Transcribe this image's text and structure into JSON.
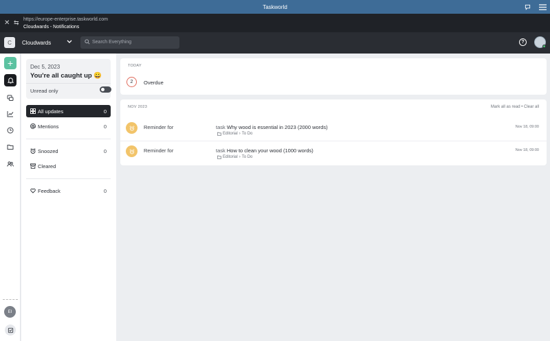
{
  "titlebar": {
    "title": "Taskworld"
  },
  "urlbar": {
    "url": "https://europe-enterprise.taskworld.com",
    "page_title": "Cloudwards - Notifications"
  },
  "header": {
    "workspace_initial": "C",
    "workspace_name": "Cloudwards",
    "search_placeholder": "Search Everything"
  },
  "rail": {
    "user_initials": "EI"
  },
  "sidebar": {
    "date": "Dec 5, 2023",
    "status_message": "You're all caught up 😀",
    "unread_only_label": "Unread only",
    "items": [
      {
        "label": "All updates",
        "count": "0"
      },
      {
        "label": "Mentions",
        "count": "0"
      },
      {
        "label": "Snoozed",
        "count": "0"
      },
      {
        "label": "Cleared",
        "count": ""
      },
      {
        "label": "Feedback",
        "count": "0"
      }
    ]
  },
  "today": {
    "label": "TODAY",
    "overdue_count": "2",
    "overdue_label": "Overdue"
  },
  "nov": {
    "label": "NOV 2023",
    "actions": "Mark all as read • Clear all",
    "notifications": [
      {
        "type": "Reminder for",
        "kind": "task",
        "title": "Why wood is essential in 2023 (2000 words)",
        "project": "Editorial",
        "list": "To Do",
        "time": "Nov 18, 09:00"
      },
      {
        "type": "Reminder for",
        "kind": "task",
        "title": "How to clean your wood (1000 words)",
        "project": "Editorial",
        "list": "To Do",
        "time": "Nov 18, 09:00"
      }
    ]
  },
  "colors": {
    "titlebar": "#3e6c97",
    "accent_green": "#5cc2a1",
    "overdue_ring": "#e06b5c",
    "reminder_avatar": "#f2c46a"
  }
}
